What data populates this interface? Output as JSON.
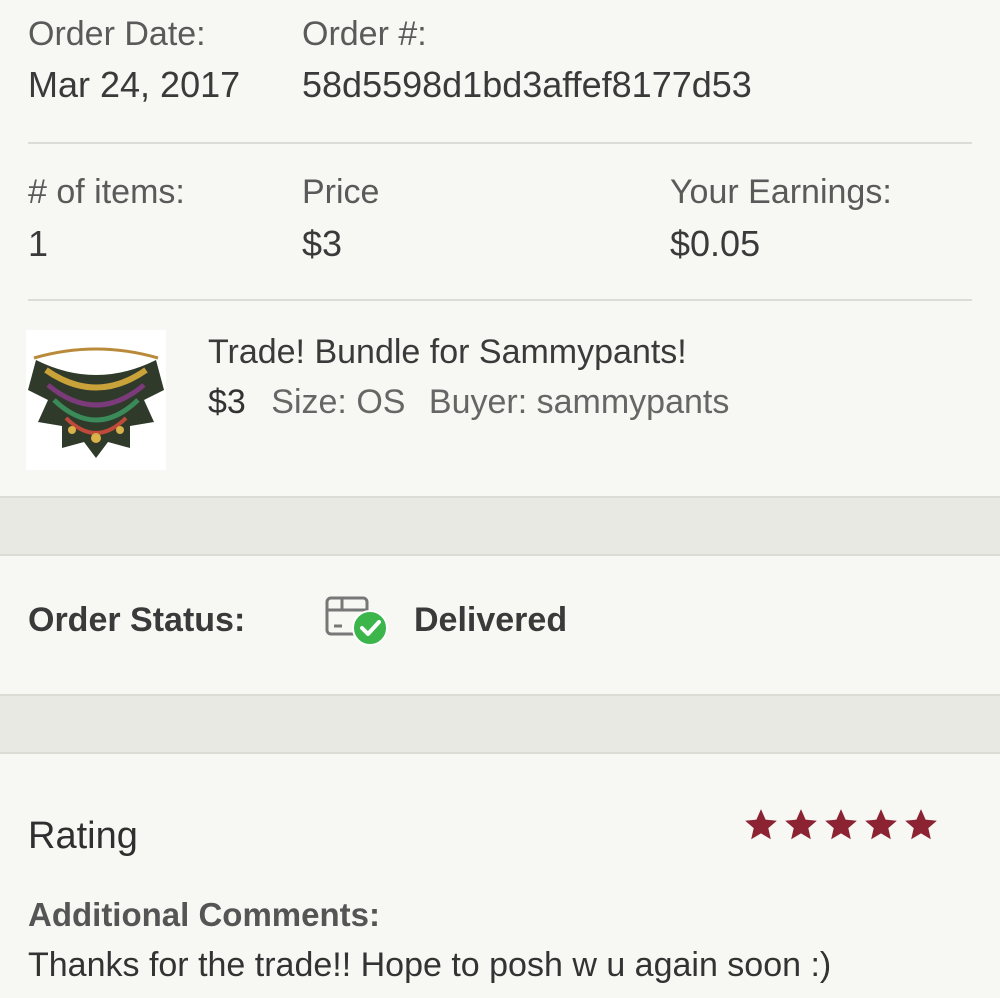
{
  "order": {
    "date_label": "Order Date:",
    "date_value": "Mar 24, 2017",
    "number_label": "Order #:",
    "number_value": "58d5598d1bd3affef8177d53"
  },
  "summary": {
    "items_label": "# of items:",
    "items_value": "1",
    "price_label": "Price",
    "price_value": "$3",
    "earnings_label": "Your Earnings:",
    "earnings_value": "$0.05"
  },
  "item": {
    "title": "Trade! Bundle for Sammypants!",
    "price": "$3",
    "size": "Size: OS",
    "buyer": "Buyer: sammypants",
    "thumbnail_icon": "necklace-thumbnail"
  },
  "status": {
    "label": "Order Status:",
    "value": "Delivered",
    "icon": "package-delivered-icon"
  },
  "rating": {
    "label": "Rating",
    "stars": 5,
    "max_stars": 5,
    "star_color": "#8b2332"
  },
  "comments": {
    "label": "Additional Comments:",
    "text": "Thanks for the trade!! Hope to posh w u again soon :)"
  },
  "colors": {
    "background": "#f7f7f3",
    "divider_band": "#e9e9e3",
    "delivered_check": "#3cb54a"
  }
}
